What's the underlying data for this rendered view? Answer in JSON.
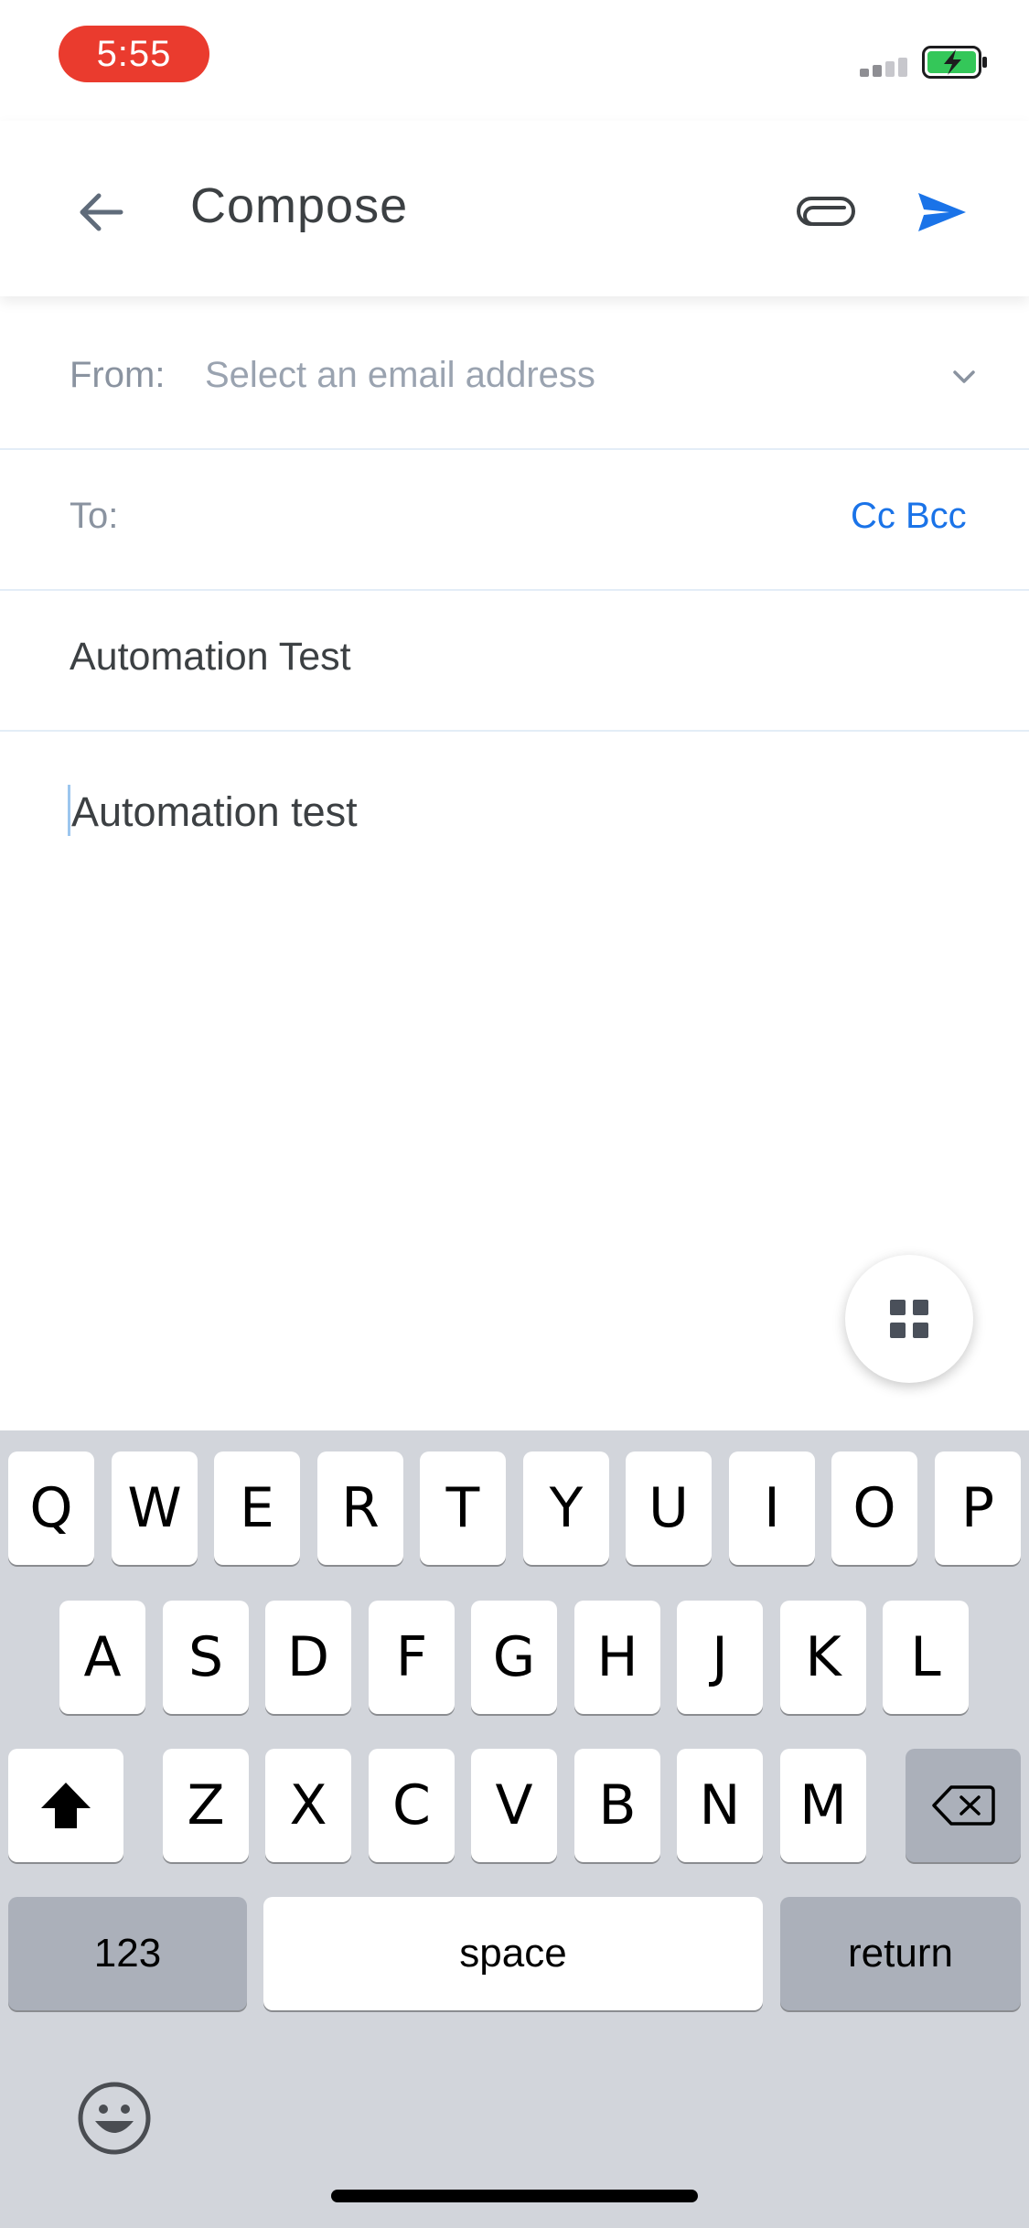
{
  "status_bar": {
    "time": "5:55"
  },
  "app_bar": {
    "title": "Compose"
  },
  "form": {
    "from_label": "From:",
    "from_placeholder": "Select an email address",
    "to_label": "To:",
    "cc_bcc_label": "Cc Bcc",
    "subject_value": "Automation Test",
    "body_value": "Automation test"
  },
  "keyboard": {
    "row1": [
      "Q",
      "W",
      "E",
      "R",
      "T",
      "Y",
      "U",
      "I",
      "O",
      "P"
    ],
    "row2": [
      "A",
      "S",
      "D",
      "F",
      "G",
      "H",
      "J",
      "K",
      "L"
    ],
    "row3": [
      "Z",
      "X",
      "C",
      "V",
      "B",
      "N",
      "M"
    ],
    "numbers_label": "123",
    "space_label": "space",
    "return_label": "return"
  },
  "colors": {
    "accent": "#1a73e8",
    "time_pill": "#ea3b2e",
    "battery": "#34c759"
  }
}
